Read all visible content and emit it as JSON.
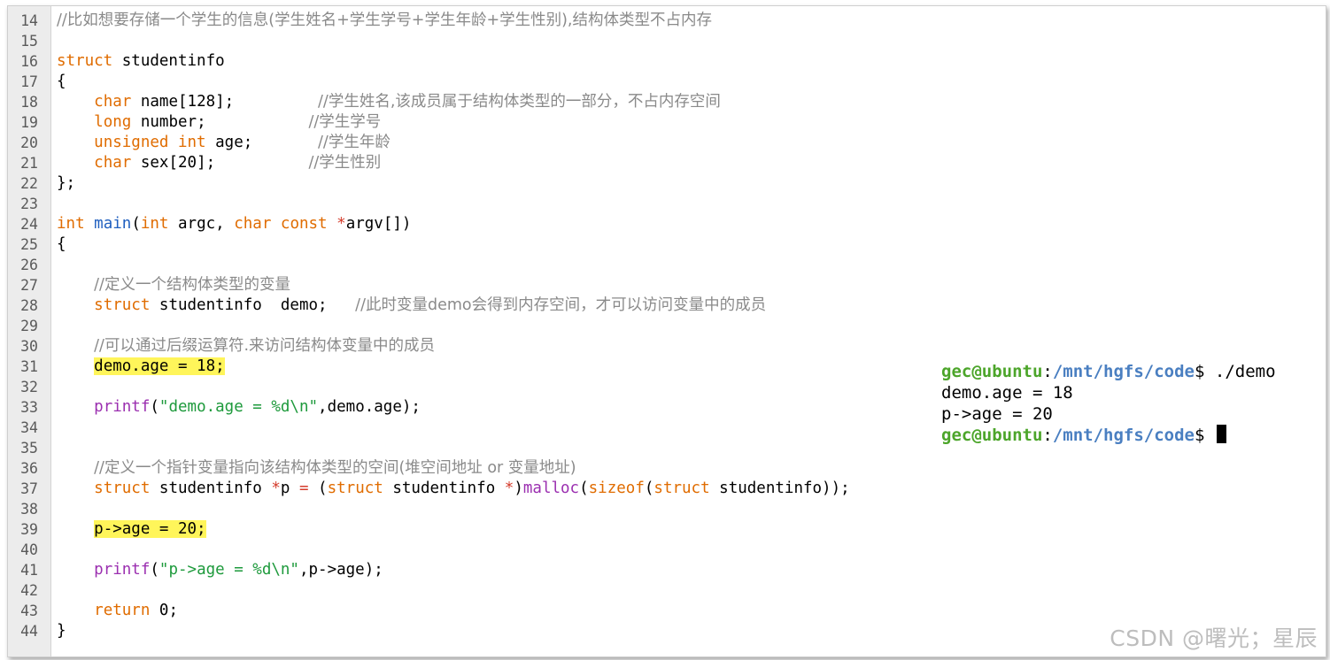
{
  "editor": {
    "lines": [
      {
        "n": "14",
        "parts": [
          {
            "c": "com",
            "t": "//比如想要存储一个学生的信息(学生姓名+学生学号+学生年龄+学生性别),结构体类型不占内存"
          }
        ]
      },
      {
        "n": "15",
        "parts": []
      },
      {
        "n": "16",
        "parts": [
          {
            "c": "kw",
            "t": "struct"
          },
          {
            "c": "",
            "t": " studentinfo"
          }
        ]
      },
      {
        "n": "17",
        "parts": [
          {
            "c": "",
            "t": "{"
          }
        ]
      },
      {
        "n": "18",
        "parts": [
          {
            "c": "",
            "t": "    "
          },
          {
            "c": "ty",
            "t": "char"
          },
          {
            "c": "",
            "t": " name[128];         "
          },
          {
            "c": "com",
            "t": "//学生姓名,该成员属于结构体类型的一部分，不占内存空间"
          }
        ]
      },
      {
        "n": "19",
        "parts": [
          {
            "c": "",
            "t": "    "
          },
          {
            "c": "ty",
            "t": "long"
          },
          {
            "c": "",
            "t": " number;           "
          },
          {
            "c": "com",
            "t": "//学生学号"
          }
        ]
      },
      {
        "n": "20",
        "parts": [
          {
            "c": "",
            "t": "    "
          },
          {
            "c": "ty",
            "t": "unsigned int"
          },
          {
            "c": "",
            "t": " age;       "
          },
          {
            "c": "com",
            "t": "//学生年龄"
          }
        ]
      },
      {
        "n": "21",
        "parts": [
          {
            "c": "",
            "t": "    "
          },
          {
            "c": "ty",
            "t": "char"
          },
          {
            "c": "",
            "t": " sex[20];          "
          },
          {
            "c": "com",
            "t": "//学生性别"
          }
        ]
      },
      {
        "n": "22",
        "parts": [
          {
            "c": "",
            "t": "};"
          }
        ]
      },
      {
        "n": "23",
        "parts": []
      },
      {
        "n": "24",
        "parts": [
          {
            "c": "ty",
            "t": "int"
          },
          {
            "c": "",
            "t": " "
          },
          {
            "c": "fn",
            "t": "main"
          },
          {
            "c": "",
            "t": "("
          },
          {
            "c": "ty",
            "t": "int"
          },
          {
            "c": "",
            "t": " argc, "
          },
          {
            "c": "ty",
            "t": "char const"
          },
          {
            "c": "",
            "t": " "
          },
          {
            "c": "op",
            "t": "*"
          },
          {
            "c": "",
            "t": "argv[])"
          }
        ]
      },
      {
        "n": "25",
        "parts": [
          {
            "c": "",
            "t": "{"
          }
        ]
      },
      {
        "n": "26",
        "parts": []
      },
      {
        "n": "27",
        "parts": [
          {
            "c": "",
            "t": "    "
          },
          {
            "c": "com",
            "t": "//定义一个结构体类型的变量"
          }
        ]
      },
      {
        "n": "28",
        "parts": [
          {
            "c": "",
            "t": "    "
          },
          {
            "c": "kw",
            "t": "struct"
          },
          {
            "c": "",
            "t": " studentinfo  demo;   "
          },
          {
            "c": "com",
            "t": "//此时变量demo会得到内存空间，才可以访问变量中的成员"
          }
        ]
      },
      {
        "n": "29",
        "parts": []
      },
      {
        "n": "30",
        "parts": [
          {
            "c": "",
            "t": "    "
          },
          {
            "c": "com",
            "t": "//可以通过后缀运算符.来访问结构体变量中的成员"
          }
        ]
      },
      {
        "n": "31",
        "parts": [
          {
            "c": "",
            "t": "    "
          },
          {
            "c": "hl",
            "t": "demo.age = 18;"
          }
        ]
      },
      {
        "n": "32",
        "parts": []
      },
      {
        "n": "33",
        "parts": [
          {
            "c": "",
            "t": "    "
          },
          {
            "c": "lib",
            "t": "printf"
          },
          {
            "c": "",
            "t": "("
          },
          {
            "c": "str",
            "t": "\"demo.age = %d\\n\""
          },
          {
            "c": "",
            "t": ",demo.age);"
          }
        ]
      },
      {
        "n": "34",
        "parts": []
      },
      {
        "n": "35",
        "parts": []
      },
      {
        "n": "36",
        "parts": [
          {
            "c": "",
            "t": "    "
          },
          {
            "c": "com",
            "t": "//定义一个指针变量指向该结构体类型的空间(堆空间地址 or 变量地址)"
          }
        ]
      },
      {
        "n": "37",
        "parts": [
          {
            "c": "",
            "t": "    "
          },
          {
            "c": "kw",
            "t": "struct"
          },
          {
            "c": "",
            "t": " studentinfo "
          },
          {
            "c": "op",
            "t": "*"
          },
          {
            "c": "",
            "t": "p "
          },
          {
            "c": "op",
            "t": "="
          },
          {
            "c": "",
            "t": " ("
          },
          {
            "c": "kw",
            "t": "struct"
          },
          {
            "c": "",
            "t": " studentinfo "
          },
          {
            "c": "op",
            "t": "*"
          },
          {
            "c": "",
            "t": ")"
          },
          {
            "c": "lib",
            "t": "malloc"
          },
          {
            "c": "",
            "t": "("
          },
          {
            "c": "kw",
            "t": "sizeof"
          },
          {
            "c": "",
            "t": "("
          },
          {
            "c": "kw",
            "t": "struct"
          },
          {
            "c": "",
            "t": " studentinfo));"
          }
        ]
      },
      {
        "n": "38",
        "parts": []
      },
      {
        "n": "39",
        "parts": [
          {
            "c": "",
            "t": "    "
          },
          {
            "c": "hl",
            "t": "p->age = 20;"
          }
        ]
      },
      {
        "n": "40",
        "parts": []
      },
      {
        "n": "41",
        "parts": [
          {
            "c": "",
            "t": "    "
          },
          {
            "c": "lib",
            "t": "printf"
          },
          {
            "c": "",
            "t": "("
          },
          {
            "c": "str",
            "t": "\"p->age = %d\\n\""
          },
          {
            "c": "",
            "t": ",p->age);"
          }
        ]
      },
      {
        "n": "42",
        "parts": []
      },
      {
        "n": "43",
        "parts": [
          {
            "c": "",
            "t": "    "
          },
          {
            "c": "kw",
            "t": "return"
          },
          {
            "c": "",
            "t": " 0;"
          }
        ]
      },
      {
        "n": "44",
        "parts": [
          {
            "c": "",
            "t": "}"
          }
        ]
      }
    ]
  },
  "terminal": {
    "prompt_user": "gec@ubuntu",
    "prompt_sep": ":",
    "prompt_path": "/mnt/hgfs/code",
    "prompt_end": "$ ",
    "command": "./demo",
    "output": [
      "demo.age = 18",
      "p->age = 20"
    ]
  },
  "watermark": "CSDN @曙光；星辰",
  "colors": {
    "keyword": "#e06c00",
    "function": "#1f5fbf",
    "library_call": "#9b2fb0",
    "string": "#1e9a3c",
    "comment": "#8a8a8a",
    "highlight": "#fff55a",
    "prompt_user": "#4ca52a",
    "prompt_path": "#4a7fc1"
  }
}
